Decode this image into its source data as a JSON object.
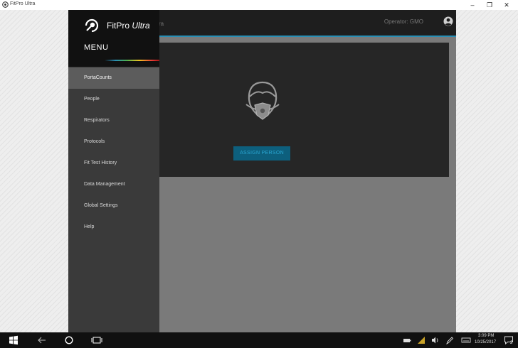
{
  "window": {
    "title": "FitPro Ultra",
    "minimize_glyph": "–",
    "maximize_glyph": "❐",
    "close_glyph": "✕"
  },
  "header": {
    "crumb": "ra",
    "operator": "Operator: GMO"
  },
  "brand": {
    "name": "FitPro",
    "suffix": "Ultra"
  },
  "menu": {
    "heading": "MENU",
    "items": [
      {
        "label": "PortaCounts",
        "active": true
      },
      {
        "label": "People"
      },
      {
        "label": "Respirators"
      },
      {
        "label": "Protocols"
      },
      {
        "label": "Fit Test History"
      },
      {
        "label": "Data Management"
      },
      {
        "label": "Global Settings"
      },
      {
        "label": "Help"
      }
    ]
  },
  "main": {
    "assign_button": "ASSIGN PERSON"
  },
  "taskbar": {
    "time": "3:09 PM",
    "date": "10/25/2017",
    "notification_count": "2"
  },
  "colors": {
    "accent": "#2a8fb5",
    "button_bg": "#0d5f7d",
    "button_text": "#2aa7d4"
  },
  "icons": [
    "tsi-logo-icon",
    "user-icon",
    "mask-icon",
    "windows-start-icon",
    "back-arrow-icon",
    "search-circle-icon",
    "task-view-icon",
    "battery-icon",
    "network-icon",
    "volume-icon",
    "pen-icon",
    "keyboard-icon",
    "notification-icon"
  ]
}
